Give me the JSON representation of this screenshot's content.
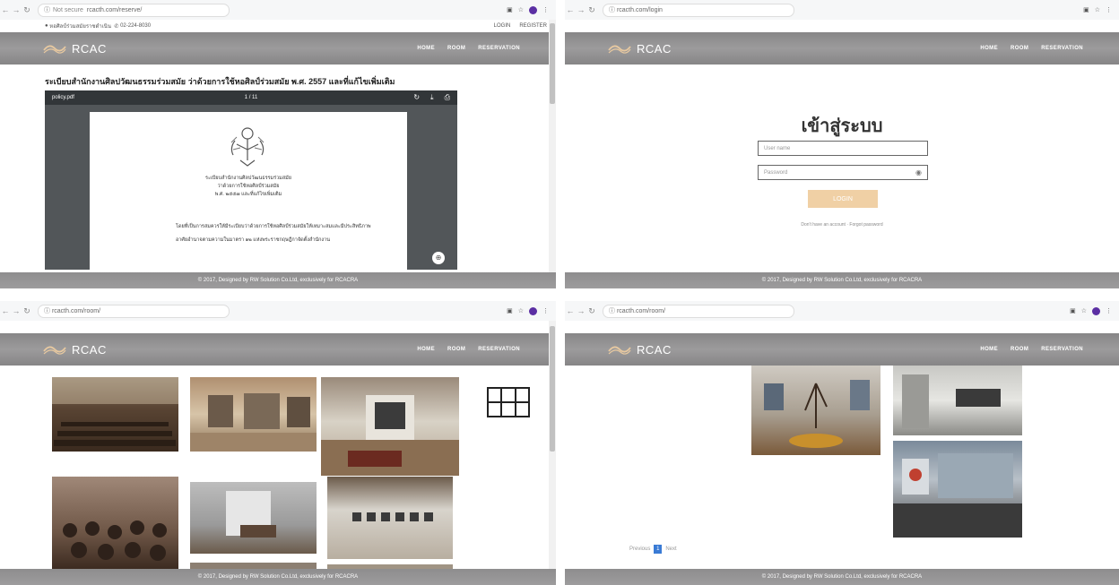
{
  "p1": {
    "url": "rcacth.com/reserve/",
    "not_secure": "Not secure",
    "topbar_left": "หอศิลป์ร่วมสมัยราชดำเนิน",
    "topbar_phone": "02-224-8030",
    "login": "LOGIN",
    "register": "REGISTER",
    "brand": "RCAC",
    "menu": [
      "HOME",
      "ROOM",
      "RESERVATION"
    ],
    "doc_title": "ระเบียบสำนักงานศิลปวัฒนธรรมร่วมสมัย ว่าด้วยการใช้หอศิลป์ร่วมสมัย พ.ศ. 2557 และที่แก้ไขเพิ่มเติม",
    "pdf_name": "policy.pdf",
    "pdf_pages": "1 / 11",
    "doc_heading1": "ระเบียบสำนักงานศิลปวัฒนธรรมร่วมสมัย",
    "doc_heading2": "ว่าด้วยการใช้หอศิลป์ร่วมสมัย",
    "doc_heading3": "พ.ศ. ๒๕๕๗ และที่แก้ไขเพิ่มเติม",
    "doc_body1": "โดยที่เป็นการสมควรให้มีระเบียบว่าด้วยการใช้หอศิลป์ร่วมสมัยให้เหมาะสมและมีประสิทธิภาพ",
    "doc_body2": "อาศัยอำนาจตามความในมาตรา ๑๒ แห่งพระราชกฤษฎีกาจัดตั้งสำนักงาน",
    "footer": "© 2017, Designed by RW Solution Co.Ltd, exclusively for RCACRA"
  },
  "p2": {
    "url": "rcacth.com/login",
    "brand": "RCAC",
    "menu": [
      "HOME",
      "ROOM",
      "RESERVATION"
    ],
    "login_title": "เข้าสู่ระบบ",
    "username_placeholder": "User name",
    "password_placeholder": "Password",
    "login_button": "LOGIN",
    "links": "Don't have an account · Forgot password",
    "footer": "© 2017, Designed by RW Solution Co.Ltd, exclusively for RCACRA"
  },
  "p3": {
    "url": "rcacth.com/room/",
    "brand": "RCAC",
    "menu": [
      "HOME",
      "ROOM",
      "RESERVATION"
    ],
    "footer": "© 2017, Designed by RW Solution Co.Ltd, exclusively for RCACRA"
  },
  "p4": {
    "url": "rcacth.com/room/",
    "brand": "RCAC",
    "menu": [
      "HOME",
      "ROOM",
      "RESERVATION"
    ],
    "pager_prev": "Previous",
    "pager_page": "1",
    "pager_next": "Next",
    "footer": "© 2017, Designed by RW Solution Co.Ltd, exclusively for RCACRA"
  }
}
